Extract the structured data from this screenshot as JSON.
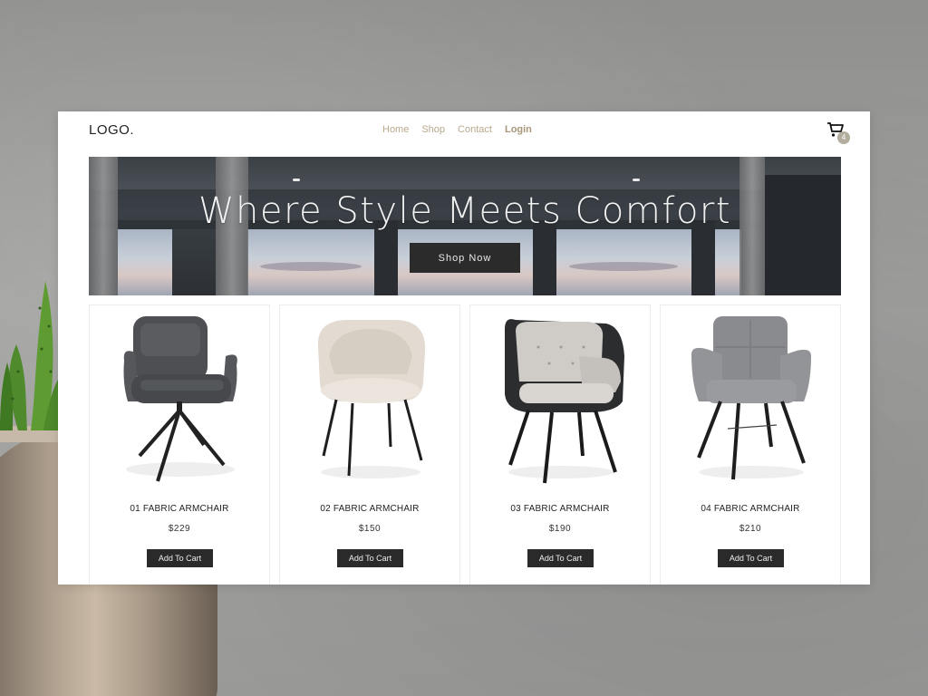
{
  "header": {
    "logo": "LOGO.",
    "nav": [
      "Home",
      "Shop",
      "Contact",
      "Login"
    ],
    "cart_count": "4",
    "cart_icon": "cart-icon"
  },
  "hero": {
    "title": "Where Style Meets Comfort",
    "button": "Shop Now"
  },
  "products": [
    {
      "name": "01 FABRIC ARMCHAIR",
      "price": "$229",
      "button": "Add To Cart"
    },
    {
      "name": "02 FABRIC ARMCHAIR",
      "price": "$150",
      "button": "Add To Cart"
    },
    {
      "name": "03 FABRIC ARMCHAIR",
      "price": "$190",
      "button": "Add To Cart"
    },
    {
      "name": "04 FABRIC ARMCHAIR",
      "price": "$210",
      "button": "Add To Cart"
    }
  ],
  "colors": {
    "nav_text": "#b9a98c",
    "button_dark": "#2a2a2a",
    "badge": "#b3ad9e"
  }
}
